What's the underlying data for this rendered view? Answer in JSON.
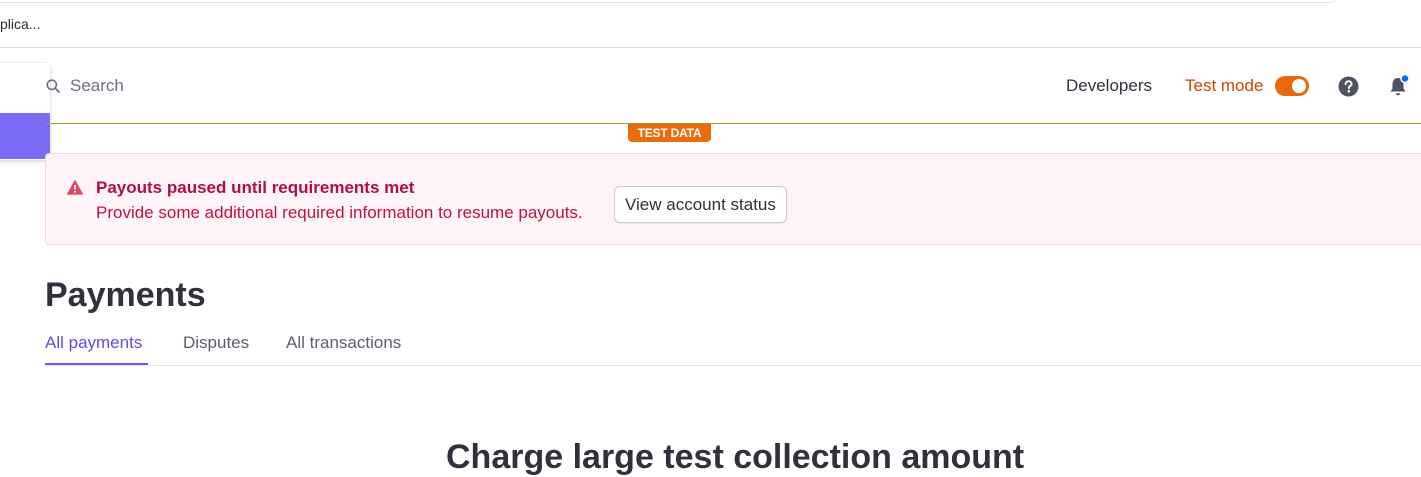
{
  "browser": {
    "bookmark_text": "plica..."
  },
  "header": {
    "search_label": "Search",
    "developers_label": "Developers",
    "test_mode_label": "Test mode",
    "test_mode_enabled": true
  },
  "test_badge": {
    "label": "TEST DATA"
  },
  "alert": {
    "title": "Payouts paused until requirements met",
    "body": "Provide some additional required information to resume payouts.",
    "button_label": "View account status"
  },
  "page": {
    "title": "Payments",
    "tabs": [
      {
        "label": "All payments",
        "active": true
      },
      {
        "label": "Disputes",
        "active": false
      },
      {
        "label": "All transactions",
        "active": false
      }
    ],
    "bottom_heading": "Charge large test collection amount"
  },
  "colors": {
    "accent": "#635bff",
    "test_mode": "#e96d0d",
    "alert_text": "#c0123f",
    "notification_dot": "#0a6cff"
  },
  "icons": {
    "search": "search-icon",
    "help": "help-icon",
    "bell": "bell-icon",
    "alert": "warning-icon"
  }
}
